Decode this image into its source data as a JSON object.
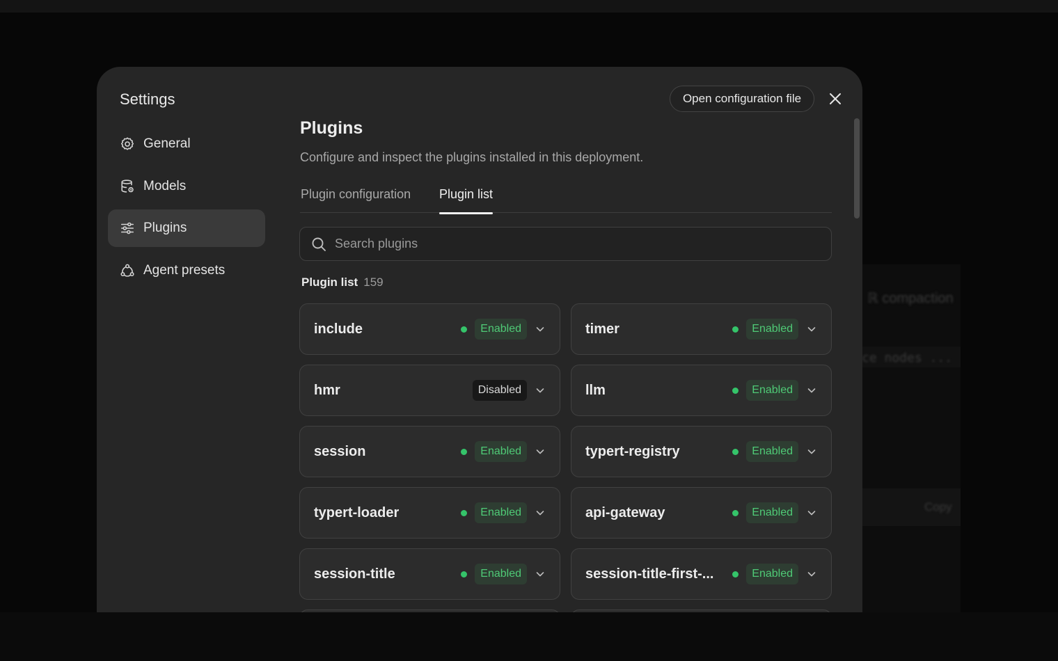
{
  "background": {
    "texts": [
      "ℝ compaction",
      "ce nodes ...",
      "Copy"
    ]
  },
  "settings": {
    "title": "Settings",
    "nav": [
      {
        "label": "General",
        "icon": "gear-icon"
      },
      {
        "label": "Models",
        "icon": "database-icon"
      },
      {
        "label": "Plugins",
        "icon": "sliders-icon",
        "active": true
      },
      {
        "label": "Agent presets",
        "icon": "presets-icon"
      }
    ],
    "open_config_label": "Open configuration file"
  },
  "main": {
    "title": "Plugins",
    "description": "Configure and inspect the plugins installed in this deployment.",
    "tabs": [
      {
        "label": "Plugin configuration",
        "active": false
      },
      {
        "label": "Plugin list",
        "active": true
      }
    ],
    "search": {
      "placeholder": "Search plugins",
      "value": ""
    },
    "list_label": "Plugin list",
    "list_count": "159",
    "plugins": [
      {
        "name": "include",
        "status": "Enabled"
      },
      {
        "name": "timer",
        "status": "Enabled"
      },
      {
        "name": "hmr",
        "status": "Disabled"
      },
      {
        "name": "llm",
        "status": "Enabled"
      },
      {
        "name": "session",
        "status": "Enabled"
      },
      {
        "name": "typert-registry",
        "status": "Enabled"
      },
      {
        "name": "typert-loader",
        "status": "Enabled"
      },
      {
        "name": "api-gateway",
        "status": "Enabled"
      },
      {
        "name": "session-title",
        "status": "Enabled"
      },
      {
        "name": "session-title-first-...",
        "status": "Enabled"
      }
    ]
  },
  "colors": {
    "enabled_text": "#4fca76",
    "enabled_dot": "#35c46a",
    "modal_bg": "#262626"
  }
}
